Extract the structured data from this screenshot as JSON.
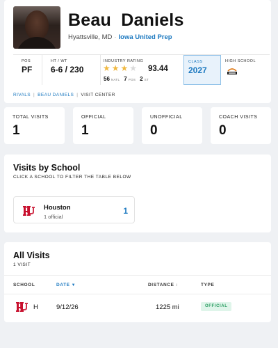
{
  "player": {
    "name": "Beau  Daniels",
    "hometown": "Hyattsville, MD",
    "separator": "·",
    "school": "Iowa United Prep"
  },
  "stats": {
    "pos_label": "POS",
    "pos": "PF",
    "htwt_label": "HT / WT",
    "htwt": "6-6 / 230",
    "rating_label": "INDUSTRY RATING",
    "stars_filled": "★★★",
    "stars_empty": "★",
    "star_count": 3,
    "rating": "93.44",
    "natl_rank": "56",
    "natl_label": "NATL",
    "pos_rank": "7",
    "pos_rank_label": "POS",
    "st_rank": "2",
    "st_label": "ST",
    "class_label": "CLASS",
    "class": "2027",
    "hs_label": "HIGH SCHOOL",
    "hs_logo": "iowa-united-logo"
  },
  "breadcrumb": {
    "items": [
      "RIVALS",
      "BEAU DANIELS"
    ],
    "current": "VISIT CENTER",
    "separator": "|"
  },
  "summary": {
    "total_label": "TOTAL VISITS",
    "total": "1",
    "official_label": "OFFICIAL",
    "official": "1",
    "unofficial_label": "UNOFFICIAL",
    "unofficial": "0",
    "coach_label": "COACH VISITS",
    "coach": "0"
  },
  "by_school": {
    "title": "Visits by School",
    "subtitle": "CLICK A SCHOOL TO FILTER THE TABLE BELOW",
    "schools": [
      {
        "name": "Houston",
        "detail": "1 official",
        "count": "1",
        "logo": "uh-logo"
      }
    ]
  },
  "all_visits": {
    "title": "All Visits",
    "subtitle": "1 VISIT",
    "columns": {
      "school": "SCHOOL",
      "date": "DATE",
      "date_sort": "▼",
      "distance": "DISTANCE",
      "distance_sort": "↕",
      "type": "TYPE"
    },
    "rows": [
      {
        "school": "H",
        "date": "9/12/26",
        "distance": "1225 mi",
        "type": "OFFICIAL",
        "logo": "uh-logo"
      }
    ]
  },
  "colors": {
    "accent": "#1c79c0",
    "star": "#f0b840",
    "uh_red": "#c8102e",
    "official_badge_bg": "#dff5ea",
    "official_badge_text": "#2b9d62",
    "page_bg": "#eff1f4"
  }
}
